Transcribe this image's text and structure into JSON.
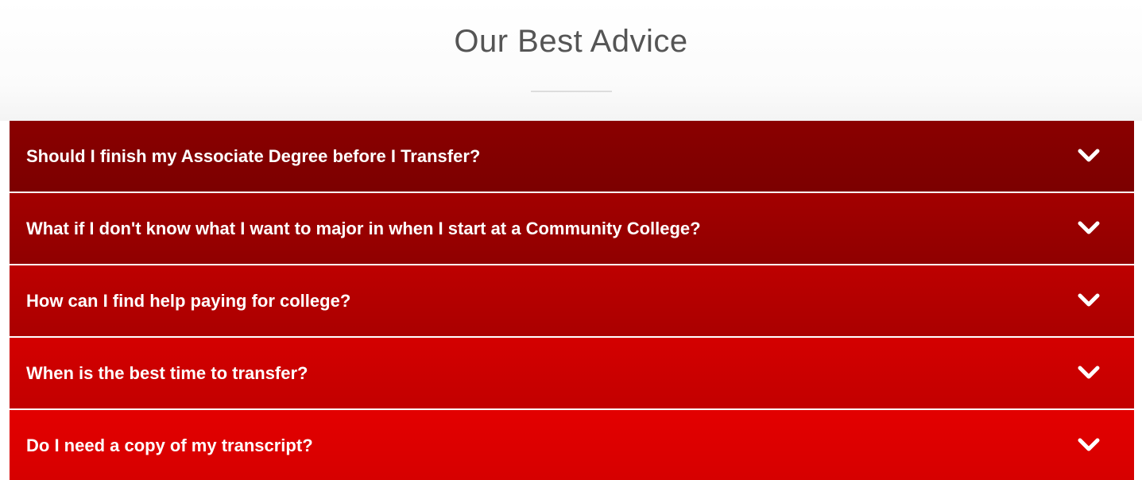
{
  "section": {
    "title": "Our Best Advice"
  },
  "accordion": {
    "items": [
      {
        "question": "Should I finish my Associate Degree before I Transfer?",
        "icon": "chevron-down-icon"
      },
      {
        "question": "What if I don't know what I want to major in when I start at a Community College?",
        "icon": "chevron-down-icon"
      },
      {
        "question": "How can I find help paying for college?",
        "icon": "chevron-down-icon"
      },
      {
        "question": "When is the best time to transfer?",
        "icon": "chevron-down-icon"
      },
      {
        "question": "Do I need a copy of my transcript?",
        "icon": "chevron-down-icon"
      }
    ]
  },
  "colors": {
    "title_text": "#555555",
    "row_darkest": "#8a0000",
    "row_brightest": "#e30000",
    "question_text": "#ffffff"
  }
}
